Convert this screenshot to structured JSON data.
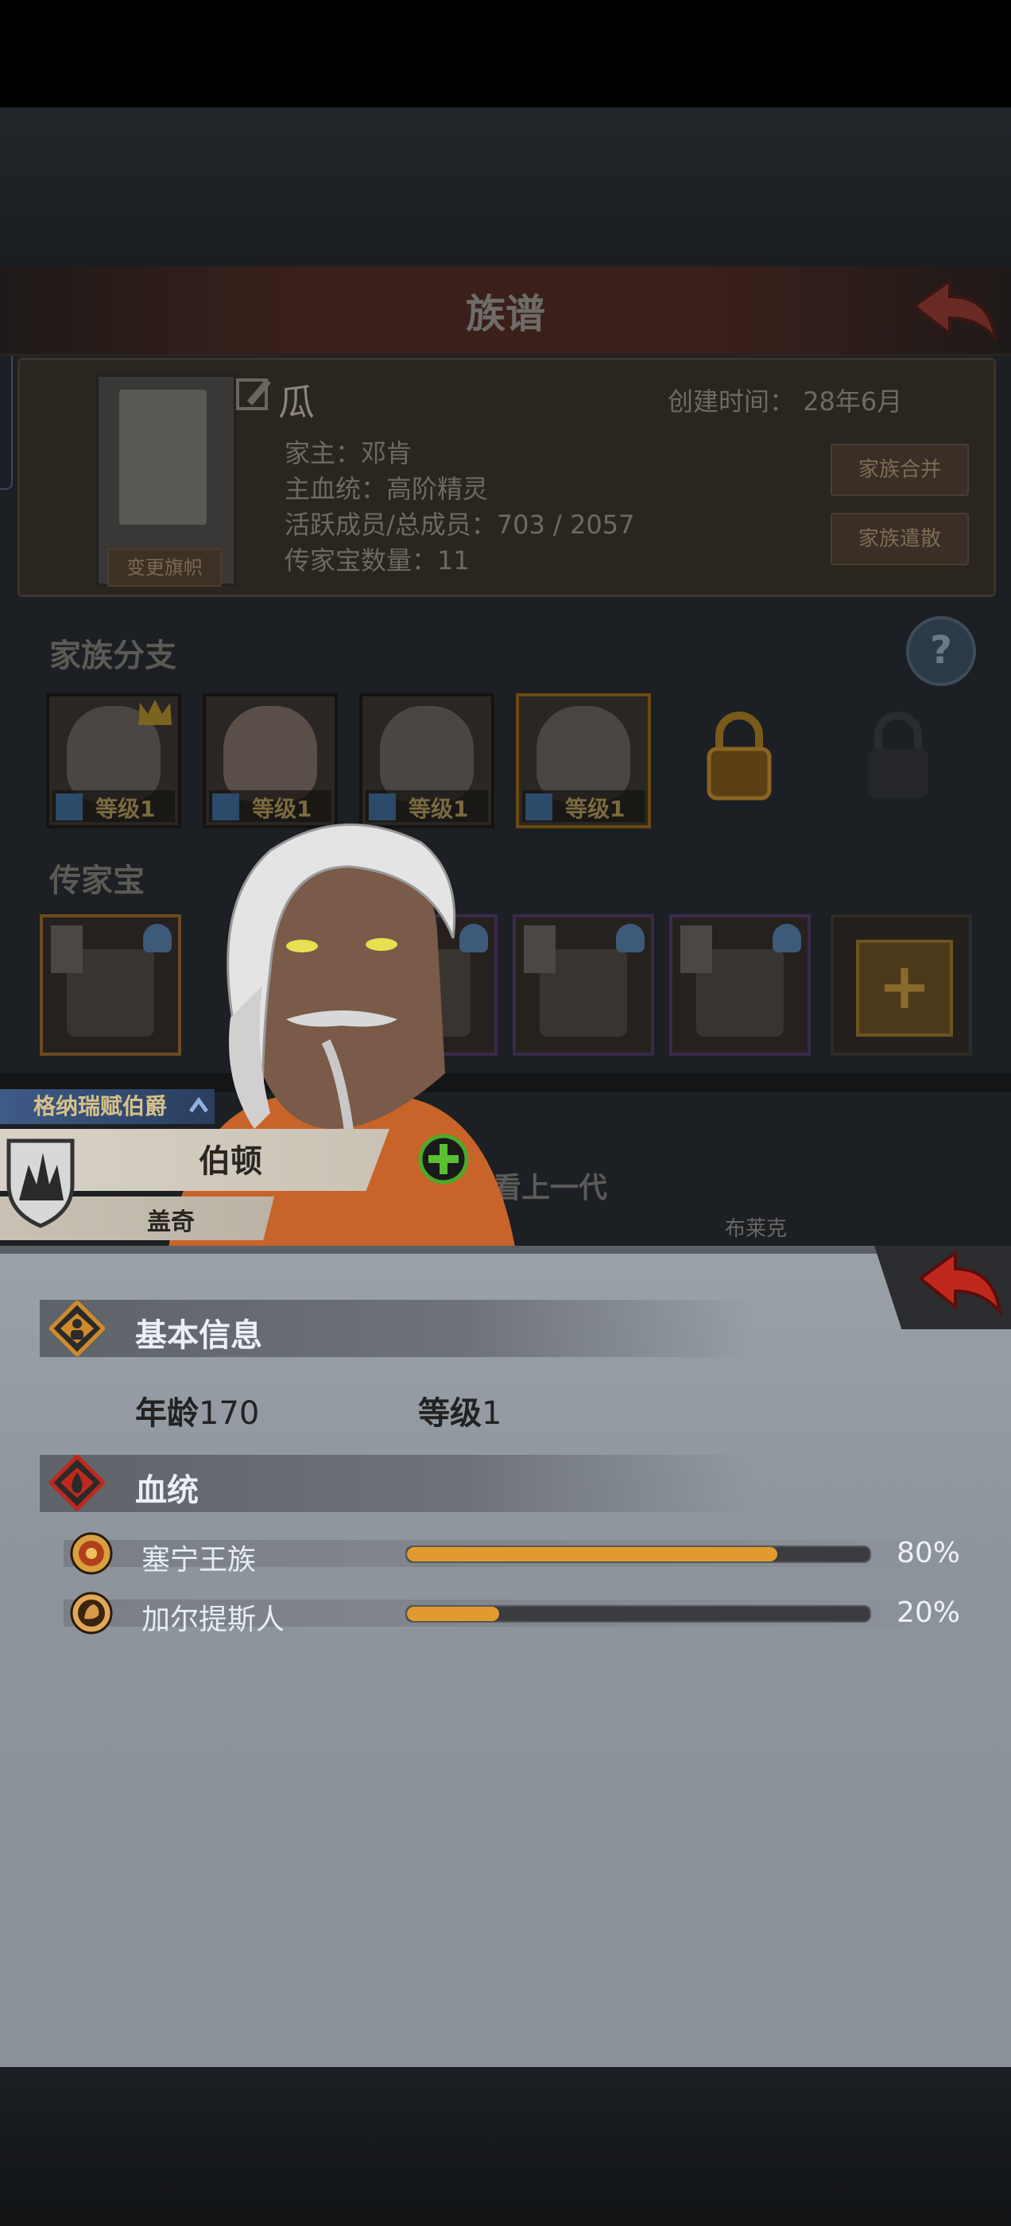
{
  "header": {
    "title": "族谱"
  },
  "family": {
    "change_banner_label": "变更旗帜",
    "name": "瓜",
    "create_time_label": "创建时间：",
    "create_time_value": "28年6月",
    "house_head": "家主：邓肯",
    "main_bloodline": "主血统：高阶精灵",
    "members": "活跃成员/总成员：703 / 2057",
    "heirloom_count": "传家宝数量：11",
    "merge_label": "家族合并",
    "dissolve_label": "家族遣散"
  },
  "branches": {
    "section_label": "家族分支",
    "help": "?",
    "items": [
      {
        "level": "等级1"
      },
      {
        "level": "等级1"
      },
      {
        "level": "等级1"
      },
      {
        "level": "等级1"
      }
    ]
  },
  "heirlooms": {
    "section_label": "传家宝",
    "add": "+"
  },
  "lineage": {
    "see_previous": "看上一代",
    "other_name": "布莱克"
  },
  "character": {
    "title_badge": "格纳瑞赋伯爵",
    "name": "伯顿",
    "spouse": "盖奇"
  },
  "basic_info": {
    "title": "基本信息",
    "age_label": "年龄",
    "age_value": "170",
    "level_label": "等级",
    "level_value": "1"
  },
  "bloodline": {
    "title": "血统",
    "items": [
      {
        "name": "塞宁王族",
        "percent": "80%",
        "fraction": 0.8
      },
      {
        "name": "加尔提斯人",
        "percent": "20%",
        "fraction": 0.2
      }
    ]
  },
  "colors": {
    "bar_fill": "#e29a2e",
    "accent_red": "#c0281e"
  }
}
